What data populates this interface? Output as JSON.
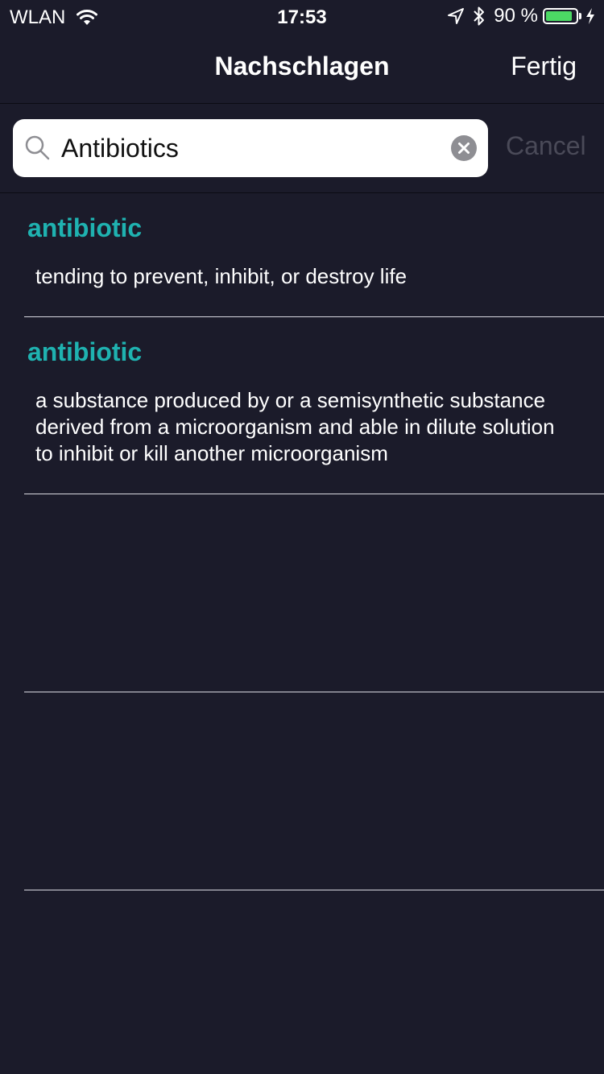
{
  "status_bar": {
    "carrier": "WLAN",
    "time": "17:53",
    "battery_percent": "90 %",
    "battery_level": 0.9,
    "battery_color": "#4cd964",
    "icons": [
      "wifi-icon",
      "location-arrow-icon",
      "bluetooth-icon",
      "battery-icon",
      "charging-bolt-icon"
    ]
  },
  "nav": {
    "title": "Nachschlagen",
    "done_label": "Fertig"
  },
  "search": {
    "value": "Antibiotics",
    "cancel_label": "Cancel",
    "icons": [
      "search-icon",
      "clear-icon"
    ]
  },
  "results": [
    {
      "title": "antibiotic",
      "definition": "tending to prevent, inhibit, or destroy life"
    },
    {
      "title": "antibiotic",
      "definition": "a substance produced by or a semisynthetic substance derived from a microorganism and able in dilute solution to inhibit or kill another microorganism"
    }
  ],
  "colors": {
    "background": "#1b1b2a",
    "accent_title": "#1fb2b0",
    "separator": "#d8d8e0"
  }
}
